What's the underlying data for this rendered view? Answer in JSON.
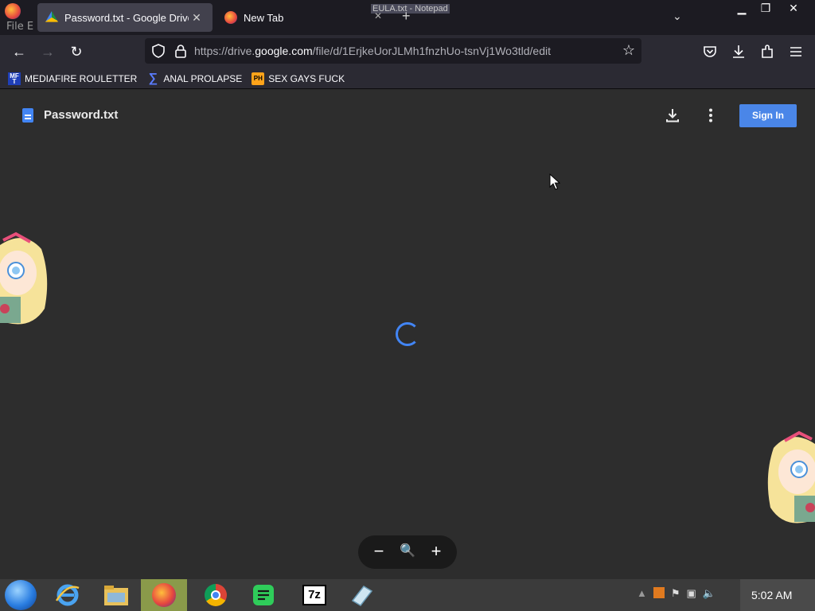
{
  "browser": {
    "background_window_menu": "File  E",
    "tabs": [
      {
        "title": "Password.txt - Google Drive",
        "active": true
      },
      {
        "title": "New Tab",
        "active": false
      }
    ],
    "background_window_title": "EULA.txt - Notepad",
    "url_prefix": "https://drive.",
    "url_domain": "google.com",
    "url_suffix": "/file/d/1ErjkeUorJLMh1fnzhUo-tsnVj1Wo3tld/edit"
  },
  "bookmarks": [
    {
      "label": "MEDIAFIRE ROULETTER",
      "icon": "mf-icon"
    },
    {
      "label": "ANAL PROLAPSE",
      "icon": "sigma-icon"
    },
    {
      "label": "SEX GAYS FUCK",
      "icon": "ph-icon"
    }
  ],
  "bookmark_icons": {
    "mf": "MF\nT",
    "ph": "PH"
  },
  "drive": {
    "file_name": "Password.txt",
    "sign_in_label": "Sign In",
    "accent_color": "#4a86e8"
  },
  "taskbar": {
    "clock": "5:02 AM",
    "apps": [
      "internet-explorer",
      "file-explorer",
      "firefox",
      "chrome",
      "notes",
      "7zip",
      "eraser"
    ]
  },
  "labels": {
    "seven_zip": "7z"
  }
}
